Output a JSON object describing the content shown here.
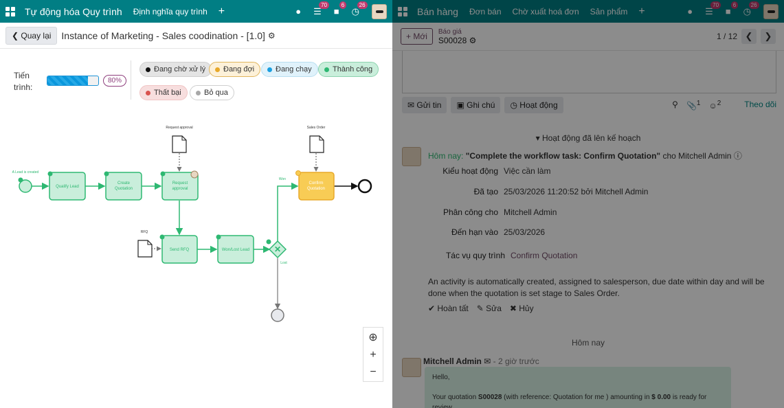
{
  "left": {
    "topbar": {
      "app_title": "Tự động hóa Quy trình",
      "menu": [
        "Định nghĩa quy trình"
      ],
      "plus": "+",
      "badges": {
        "activities": "70",
        "messages": "6",
        "timer": "26"
      }
    },
    "back_label": "Quay lại",
    "instance_title": "Instance of Marketing - Sales coodination - [1.0]",
    "progress": {
      "label": "Tiến trình:",
      "value": 0.8,
      "percent_text": "80%"
    },
    "legend": [
      {
        "label": "Đang chờ xử lý",
        "color": "#111111",
        "bg": "#e4e4e4",
        "border": "#cfcfcf"
      },
      {
        "label": "Đang đợi",
        "color": "#e8a92a",
        "bg": "#fdf1d9",
        "border": "#e0b55c"
      },
      {
        "label": "Đang chạy",
        "color": "#1a9fe0",
        "bg": "#e0f2fb",
        "border": "#b8def0"
      },
      {
        "label": "Thành công",
        "color": "#2eb872",
        "bg": "#c9eedb",
        "border": "#8cd3ae"
      },
      {
        "label": "Thất bại",
        "color": "#d9534f",
        "bg": "#f7dede",
        "border": "#f0c4c4"
      },
      {
        "label": "Bỏ qua",
        "color": "#a8a8a8",
        "bg": "#ffffff",
        "border": "#cfcfcf"
      }
    ],
    "diagram": {
      "start_label": "A Lead is created",
      "tasks": [
        "Qualify Lead",
        "Create Quotation",
        "Request approval",
        "Send RFQ",
        "Won/Lost Lead",
        "Confirm Quotation"
      ],
      "docs": [
        "Request approval",
        "Sales Order",
        "RFQ"
      ],
      "gateway_labels": [
        "Won",
        "Lost"
      ]
    },
    "zoom": {
      "center": "⊕",
      "in": "+",
      "out": "−"
    }
  },
  "right": {
    "topbar": {
      "app_title": "Bán hàng",
      "menu": [
        "Đơn bán",
        "Chờ xuất hoá đơn",
        "Sản phẩm"
      ],
      "plus": "+",
      "badges": {
        "activities": "70",
        "messages": "6",
        "timer": "26"
      }
    },
    "new_label": "+ Mới",
    "breadcrumb_parent": "Báo giá",
    "record": "S00028",
    "pager": "1 / 12",
    "chatter": {
      "send": "Gửi tin",
      "note": "Ghi chú",
      "activity": "Hoạt động",
      "attachments": "1",
      "followers": "2",
      "follow": "Theo dõi"
    },
    "planned_header": "Hoạt động đã lên kế hoạch",
    "activity": {
      "when": "Hôm nay:",
      "summary": "\"Complete the workflow task: Confirm Quotation\"",
      "for_label": "cho Mitchell Admin",
      "type_label": "Kiểu hoạt động",
      "type_value": "Việc cần làm",
      "created_label": "Đã tạo",
      "created_value": "25/03/2026 11:20:52 bởi Mitchell Admin",
      "assigned_label": "Phân công cho",
      "assigned_value": "Mitchell Admin",
      "due_label": "Đến hạn vào",
      "due_value": "25/03/2026",
      "task_label": "Tác vụ quy trình",
      "task_value": "Confirm Quotation",
      "description": "An activity is automatically created, assigned to salesperson, due date within day and will be done when the quotation is set stage to Sales Order.",
      "done": "Hoàn tất",
      "edit": "Sửa",
      "cancel": "Hủy"
    },
    "today_sep": "Hôm nay",
    "message": {
      "author": "Mitchell Admin",
      "time": "- 2 giờ trước",
      "line1": "Hello,",
      "line2_pre": "Your quotation ",
      "line2_ref": "S00028",
      "line2_mid": " (with reference: Quotation for me ) amounting in ",
      "line2_amt": "$ 0.00",
      "line2_post": " is ready for",
      "line3": "review."
    }
  }
}
